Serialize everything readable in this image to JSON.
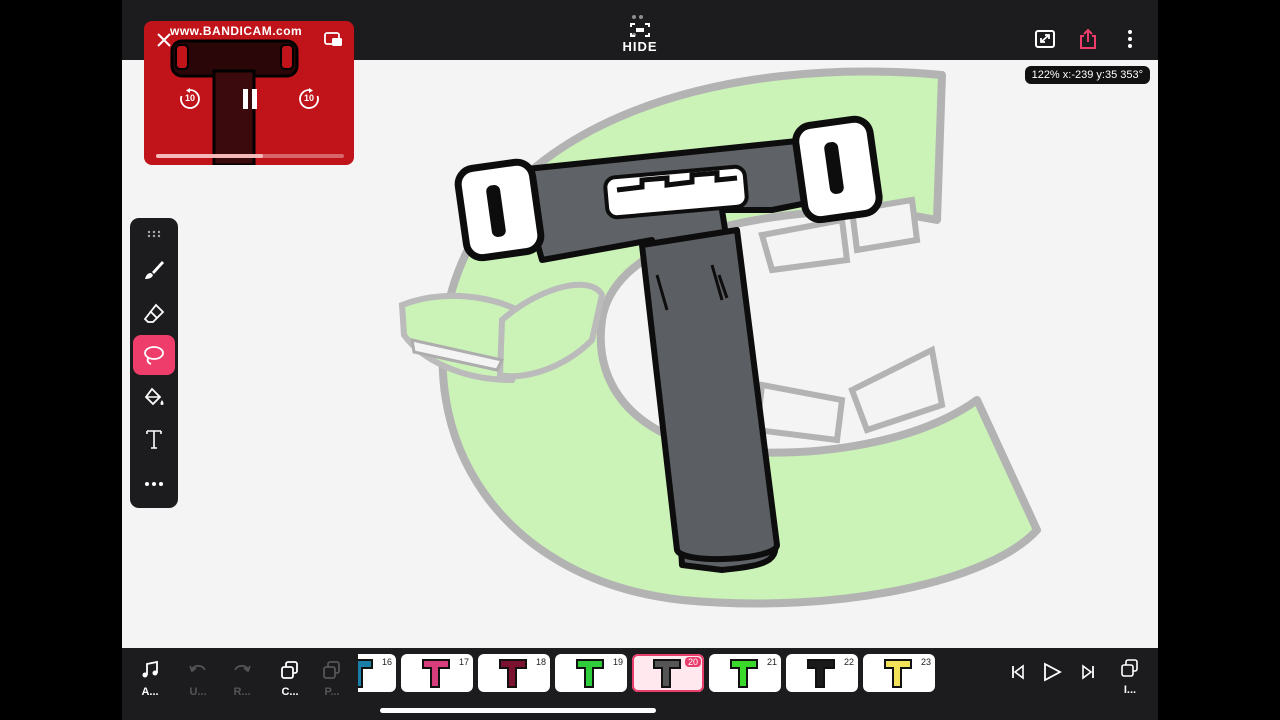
{
  "app": {
    "hide_label": "HIDE",
    "zoom_readout": "122% x:-239 y:35 353°"
  },
  "pip": {
    "watermark": "www.BANDICAM.com",
    "skip_back": "10",
    "skip_forward": "10",
    "progress": 0.57
  },
  "bottombar": {
    "audio_label": "A...",
    "undo_label": "U...",
    "redo_label": "R...",
    "copy_label": "C...",
    "paste_label": "P...",
    "layers_label": "I..."
  },
  "frames": [
    {
      "num": "16",
      "color": "#1a7fa8",
      "selected": false
    },
    {
      "num": "17",
      "color": "#d63d7a",
      "selected": false
    },
    {
      "num": "18",
      "color": "#7a1230",
      "selected": false
    },
    {
      "num": "19",
      "color": "#2fcf3b",
      "selected": false
    },
    {
      "num": "20",
      "color": "#555555",
      "selected": true
    },
    {
      "num": "21",
      "color": "#3ad92a",
      "selected": false
    },
    {
      "num": "22",
      "color": "#1a1a1a",
      "selected": false
    },
    {
      "num": "23",
      "color": "#f2e25a",
      "selected": false
    }
  ],
  "colors": {
    "accent": "#ee3d6a",
    "t_body": "#5f6266",
    "c_green": "#c9f2b4"
  }
}
